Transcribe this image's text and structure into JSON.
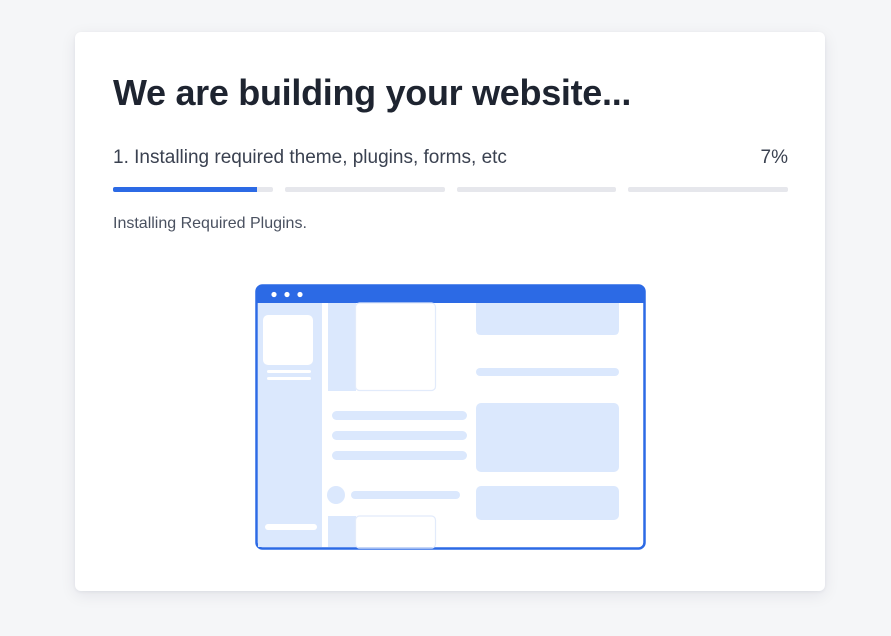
{
  "header": {
    "title": "We are building your website..."
  },
  "step": {
    "label": "1. Installing required theme, plugins, forms, etc",
    "percent_text": "7%"
  },
  "progress": {
    "segments": [
      0.9,
      0,
      0,
      0
    ],
    "fill_color": "#2c6ae5",
    "track_color": "#e6e7ec"
  },
  "status": {
    "message": "Installing Required Plugins."
  },
  "illustration": {
    "name": "website-builder-illustration",
    "accent": "#2c6ae5",
    "light": "#dbe8fd"
  }
}
